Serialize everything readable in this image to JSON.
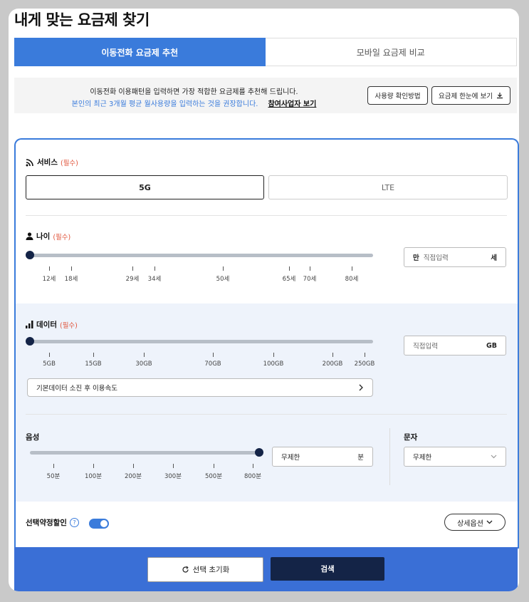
{
  "page": {
    "title": "내게 맞는 요금제 찾기"
  },
  "tabs": [
    {
      "label": "이동전화 요금제 추천",
      "active": true
    },
    {
      "label": "모바일 요금제 비교",
      "active": false
    }
  ],
  "info": {
    "line1": "이동전화 이용패턴을 입력하면 가장 적합한 요금제를 추천해 드립니다.",
    "line2": "본인의 최근 3개월 평균 월사용량을 입력하는 것을 권장합니다.",
    "link": "참여사업자 보기",
    "usage_button": "사용량 확인방법",
    "overview_button": "요금제 한눈에 보기"
  },
  "service": {
    "label": "서비스",
    "required": "(필수)",
    "options": [
      {
        "label": "5G",
        "selected": true
      },
      {
        "label": "LTE",
        "selected": false
      }
    ]
  },
  "age": {
    "label": "나이",
    "required": "(필수)",
    "ticks": [
      "12세",
      "18세",
      "29세",
      "34세",
      "50세",
      "65세",
      "70세",
      "80세"
    ],
    "slider_value": 0,
    "input_prefix": "만",
    "input_placeholder": "직접입력",
    "input_unit": "세"
  },
  "data": {
    "label": "데이터",
    "required": "(필수)",
    "ticks": [
      "5GB",
      "15GB",
      "30GB",
      "70GB",
      "100GB",
      "200GB",
      "250GB"
    ],
    "slider_value": 0,
    "input_placeholder": "직접입력",
    "input_unit": "GB",
    "speed_label": "기본데이터 소진 후 이용속도"
  },
  "voice": {
    "label": "음성",
    "ticks": [
      "50분",
      "100분",
      "200분",
      "300분",
      "500분",
      "800분"
    ],
    "slider_value": 1,
    "input_value": "무제한",
    "input_unit": "분"
  },
  "sms": {
    "label": "문자",
    "selected": "무제한"
  },
  "discount": {
    "label": "선택약정할인",
    "on": true,
    "help": "?"
  },
  "detail_button": "상세옵션",
  "footer": {
    "reset": "선택 초기화",
    "search": "검색"
  },
  "colors": {
    "accent": "#3a7bdb",
    "navy": "#142447",
    "required": "#e0533a"
  }
}
